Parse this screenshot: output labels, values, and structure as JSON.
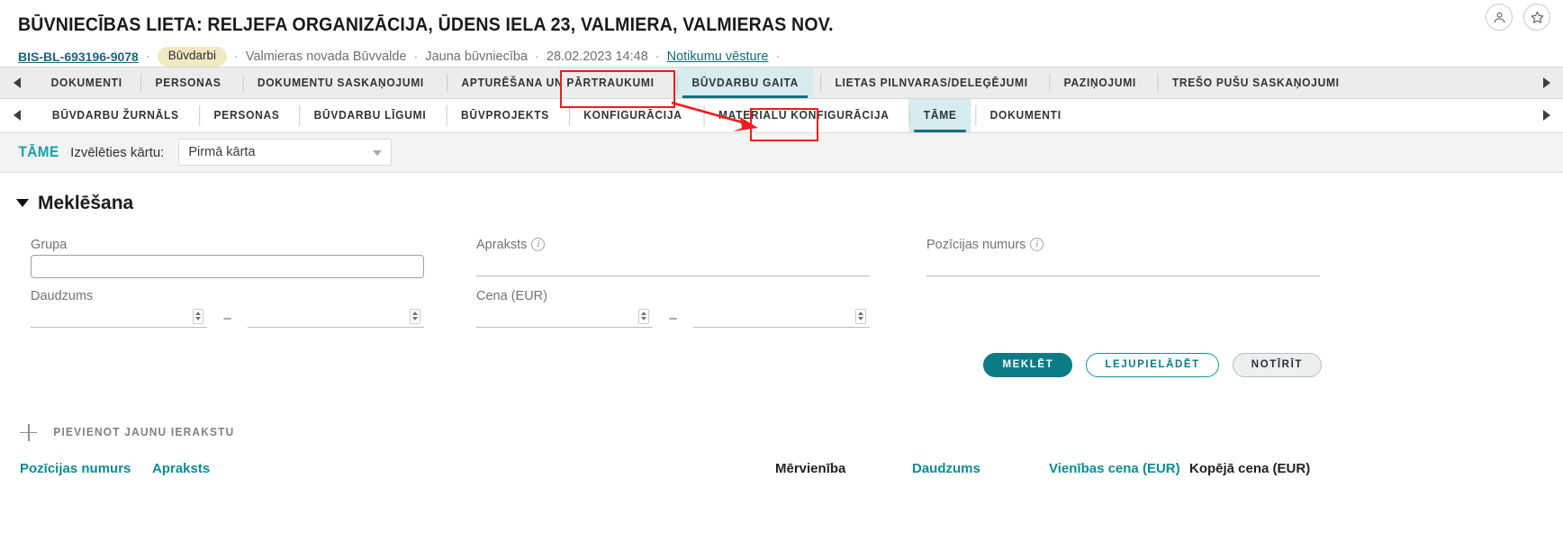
{
  "header": {
    "title": "BŪVNIECĪBAS LIETA: RELJEFA ORGANIZĀCIJA, ŪDENS IELA 23, VALMIERA, VALMIERAS NOV.",
    "case_number": "BIS-BL-693196-9078",
    "badge": "Būvdarbi",
    "authority": "Valmieras novada Būvvalde",
    "case_type": "Jauna būvniecība",
    "datetime": "28.02.2023 14:48",
    "history_link": "Notikumu vēsture",
    "separator": "·",
    "icons": {
      "account": "user-circle-icon",
      "favorite": "star-icon"
    }
  },
  "primary_tabs": {
    "prev_arrow": "chevron-left-icon",
    "next_arrow": "chevron-right-icon",
    "items": [
      {
        "label": "DOKUMENTI",
        "active": false
      },
      {
        "label": "PERSONAS",
        "active": false
      },
      {
        "label": "DOKUMENTU SASKAŅOJUMI",
        "active": false
      },
      {
        "label": "APTURĒŠANA UN PĀRTRAUKUMI",
        "active": false
      },
      {
        "label": "BŪVDARBU GAITA",
        "active": true
      },
      {
        "label": "LIETAS PILNVARAS/DELEĢĒJUMI",
        "active": false
      },
      {
        "label": "PAZIŅOJUMI",
        "active": false
      },
      {
        "label": "TREŠO PUŠU SASKAŅOJUMI",
        "active": false
      }
    ]
  },
  "secondary_tabs": {
    "prev_arrow": "chevron-left-icon",
    "next_arrow": "chevron-right-icon",
    "items": [
      {
        "label": "BŪVDARBU ŽURNĀLS",
        "active": false
      },
      {
        "label": "PERSONAS",
        "active": false
      },
      {
        "label": "BŪVDARBU LĪGUMI",
        "active": false
      },
      {
        "label": "BŪVPROJEKTS",
        "active": false
      },
      {
        "label": "KONFIGURĀCIJA",
        "active": false
      },
      {
        "label": "MATERIĀLU KONFIGURĀCIJA",
        "active": false
      },
      {
        "label": "TĀME",
        "active": true
      },
      {
        "label": "DOKUMENTI",
        "active": false
      }
    ]
  },
  "tame_bar": {
    "label": "TĀME",
    "select_label": "Izvēlēties kārtu:",
    "select_value": "Pirmā kārta",
    "caret_icon": "chevron-down-icon"
  },
  "search": {
    "section_title": "Meklēšana",
    "toggle_icon": "caret-down-icon",
    "fields": {
      "grupa": {
        "label": "Grupa",
        "value": "",
        "placeholder": ""
      },
      "daudzums": {
        "label": "Daudzums",
        "from": "",
        "to": "",
        "separator": "–"
      },
      "apraksts": {
        "label": "Apraksts",
        "value": "",
        "info_icon": "info-icon"
      },
      "cena": {
        "label": "Cena (EUR)",
        "from": "",
        "to": "",
        "separator": "–"
      },
      "pozicijas_numurs": {
        "label": "Pozīcijas numurs",
        "value": "",
        "info_icon": "info-icon"
      }
    },
    "buttons": {
      "search": "MEKLĒT",
      "download": "LEJUPIELĀDĒT",
      "clear": "NOTĪRĪT"
    }
  },
  "add_record": {
    "label": "PIEVIENOT JAUNU IERAKSTU",
    "icon": "plus-icon"
  },
  "table": {
    "columns": [
      "Pozīcijas numurs",
      "Apraksts",
      "Mērvienība",
      "Daudzums",
      "Vienības cena (EUR)",
      "Kopējā cena (EUR)"
    ]
  },
  "colors": {
    "accent": "#0b7b85",
    "accent_light": "#16a0aa",
    "tab_active_bg": "#d6ecee",
    "highlight_red": "#ee1c1c",
    "badge_bg": "#f2e9c4"
  }
}
